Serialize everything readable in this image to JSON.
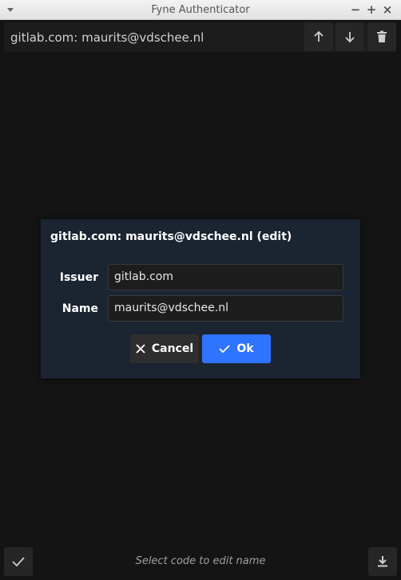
{
  "window": {
    "title": "Fyne Authenticator",
    "controls": [
      "minimize",
      "maximize",
      "close"
    ]
  },
  "toolbar": {
    "entry_label": "gitlab.com: maurits@vdschee.nl",
    "buttons": [
      {
        "name": "move-up",
        "icon": "arrow-up-icon"
      },
      {
        "name": "move-down",
        "icon": "arrow-down-icon"
      },
      {
        "name": "delete",
        "icon": "trash-icon"
      }
    ]
  },
  "dialog": {
    "title": "gitlab.com: maurits@vdschee.nl (edit)",
    "fields": [
      {
        "label": "Issuer",
        "value": "gitlab.com"
      },
      {
        "label": "Name",
        "value": "maurits@vdschee.nl"
      }
    ],
    "cancel_label": "Cancel",
    "ok_label": "Ok",
    "primary_color": "#2f74ff"
  },
  "footer": {
    "status_text": "Select code to edit name",
    "left_icon": "check-icon",
    "right_icon": "download-icon"
  },
  "colors": {
    "background": "#141414",
    "dialog": "#1b2431"
  }
}
